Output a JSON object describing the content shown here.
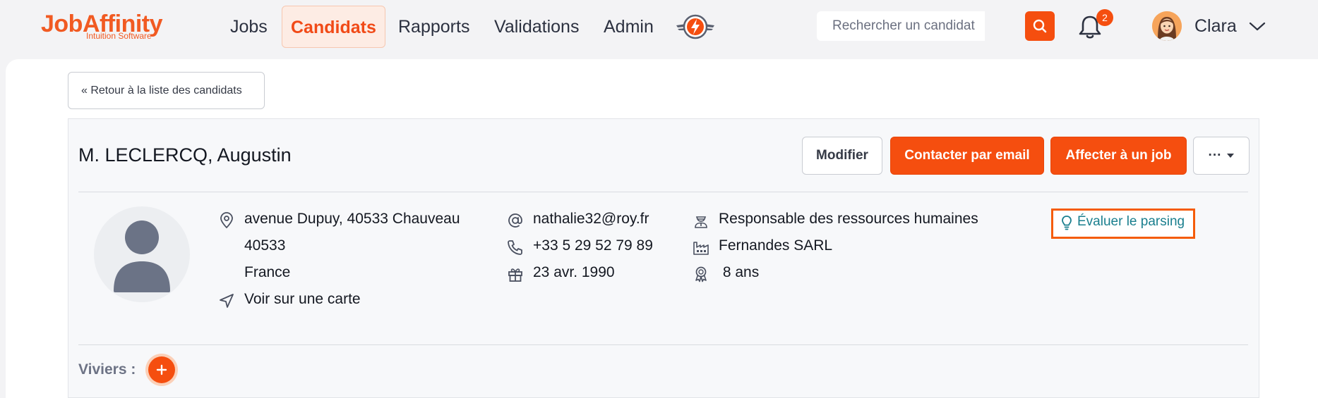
{
  "app": {
    "logo_main": "JobAffinity",
    "logo_sub": "Intuition Software",
    "accent_color": "#f54e0f"
  },
  "nav": {
    "items": [
      {
        "label": "Jobs",
        "active": false
      },
      {
        "label": "Candidats",
        "active": true
      },
      {
        "label": "Rapports",
        "active": false
      },
      {
        "label": "Validations",
        "active": false
      },
      {
        "label": "Admin",
        "active": false
      }
    ],
    "special_icon": "lightning-wing-badge-icon"
  },
  "search": {
    "placeholder": "Rechercher un candidat",
    "button_icon": "search-icon"
  },
  "notifications": {
    "count": "2",
    "icon": "bell-icon"
  },
  "user": {
    "name": "Clara",
    "icon": "chevron-down-icon"
  },
  "back_link": "« Retour à la liste des candidats",
  "candidate": {
    "name": "M. LECLERCQ, Augustin",
    "actions": {
      "edit": "Modifier",
      "contact": "Contacter par email",
      "assign": "Affecter à un job",
      "more": "···"
    },
    "address": {
      "street": "avenue Dupuy, 40533 Chauveau",
      "zip": "40533",
      "country": "France",
      "map_link": "Voir sur une carte"
    },
    "contact": {
      "email": "nathalie32@roy.fr",
      "phone": "+33 5 29 52 79 89",
      "birthday": "23 avr. 1990"
    },
    "job": {
      "title": "Responsable des ressources humaines",
      "company": "Fernandes SARL",
      "experience": " 8 ans"
    },
    "evaluate_parsing": "Évaluer le parsing"
  },
  "viviers": {
    "label": "Viviers :",
    "add_icon": "plus-icon"
  }
}
